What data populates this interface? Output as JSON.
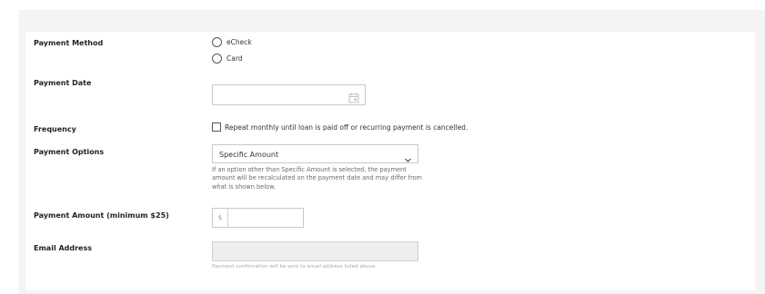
{
  "form": {
    "payment_method": {
      "label": "Payment Method",
      "options": [
        "eCheck",
        "Card"
      ]
    },
    "payment_date": {
      "label": "Payment Date",
      "value": "",
      "icon": "calendar-icon"
    },
    "frequency": {
      "label": "Frequency",
      "checkbox_label": "Repeat monthly until loan is paid off or recurring payment is cancelled."
    },
    "payment_options": {
      "label": "Payment Options",
      "selected": "Specific Amount",
      "help": "If an option other than Specific Amount is selected, the payment amount will be recalculated on the payment date and may differ from what is shown below."
    },
    "payment_amount": {
      "label": "Payment Amount (minimum $25)",
      "prefix": "$",
      "value": ""
    },
    "email": {
      "label": "Email Address",
      "value": "",
      "help": "Payment confirmation will be sent to email address listed above"
    }
  }
}
